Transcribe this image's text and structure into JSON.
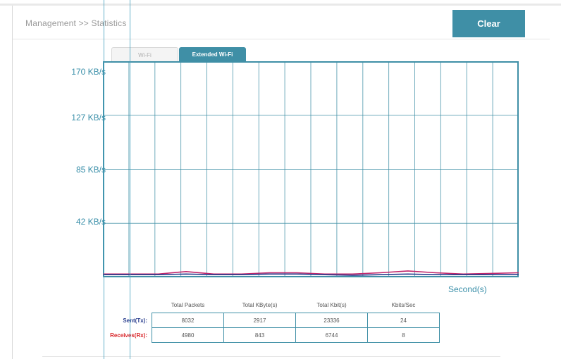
{
  "breadcrumb": "Management >> Statistics",
  "clear_label": "Clear",
  "tabs": [
    {
      "label": "Wi-Fi",
      "active": false
    },
    {
      "label": "Extended Wi-Fi",
      "active": true
    }
  ],
  "chart": {
    "y_ticks": [
      "170 KB/s",
      "127 KB/s",
      "85 KB/s",
      "42 KB/s"
    ],
    "x_unit": "Second(s)"
  },
  "chart_data": {
    "type": "line",
    "ylim": [
      0,
      170
    ],
    "y_unit": "KB/s",
    "x_label": "Second(s)",
    "grid": true,
    "series": [
      {
        "color": "#c0266b",
        "values": [
          1.5,
          1.5,
          1.5,
          3.5,
          1.5,
          1.5,
          2.5,
          2.5,
          1.5,
          1.5,
          2.5,
          4,
          2.5,
          1.5,
          2,
          2.5
        ]
      },
      {
        "color": "#2b3f8f",
        "values": [
          1,
          1,
          1,
          1.5,
          1,
          1,
          1.5,
          1.5,
          1,
          0.5,
          1,
          1.5,
          1,
          1,
          1,
          1
        ]
      }
    ],
    "colors": {
      "accent": "#3f8fa6",
      "grid": "#3f8fa6"
    }
  },
  "stats": {
    "headers": [
      "Total Packets",
      "Total KByte(s)",
      "Total Kbit(s)",
      "Kbits/Sec"
    ],
    "rows": [
      {
        "label": "Sent(Tx):",
        "values": [
          "8032",
          "2917",
          "23336",
          "24"
        ]
      },
      {
        "label": "Receives(Rx):",
        "values": [
          "4980",
          "843",
          "6744",
          "8"
        ]
      }
    ]
  }
}
